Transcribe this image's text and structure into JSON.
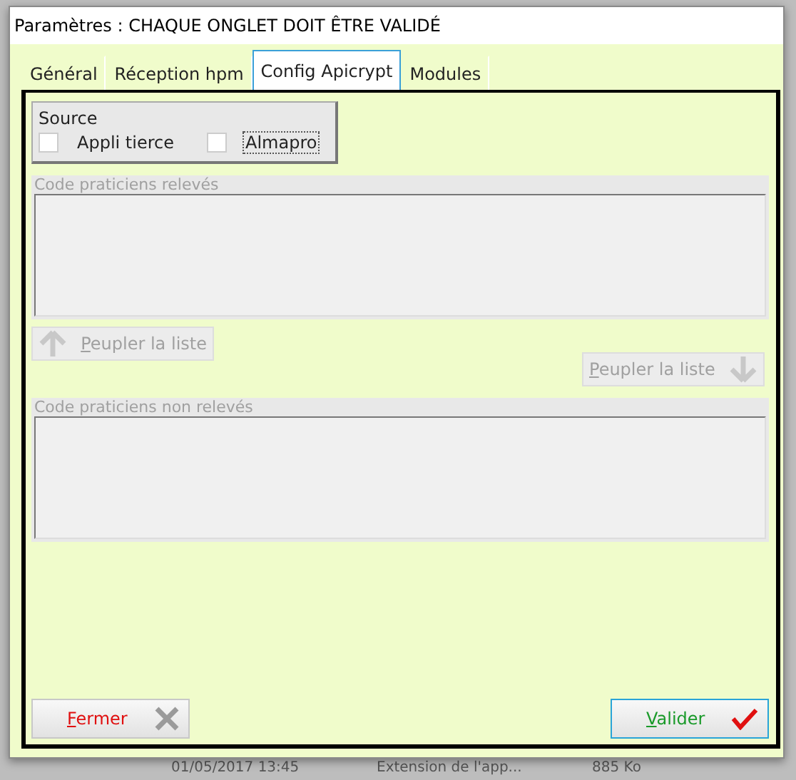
{
  "window": {
    "title": "Paramètres : CHAQUE ONGLET DOIT ÊTRE VALIDÉ"
  },
  "tabs": [
    {
      "label": "Général",
      "selected": false
    },
    {
      "label": "Réception hpm",
      "selected": false
    },
    {
      "label": "Config Apicrypt",
      "selected": true
    },
    {
      "label": "Modules",
      "selected": false
    }
  ],
  "source": {
    "title": "Source",
    "options": [
      {
        "label": "Appli tierce",
        "checked": false,
        "focused": false
      },
      {
        "label": "Almapro",
        "checked": false,
        "focused": true
      }
    ]
  },
  "list_releves": {
    "title": "Code praticiens relevés",
    "disabled": true
  },
  "move_buttons": [
    {
      "label": "Peupler la liste",
      "kind": "up",
      "disabled": true
    },
    {
      "label": "Peupler la liste",
      "kind": "down",
      "disabled": true
    }
  ],
  "list_non_releves": {
    "title": "Code praticiens non relevés",
    "disabled": true
  },
  "buttons": [
    {
      "label": "Fermer",
      "kind": "close"
    },
    {
      "label": "Valider",
      "kind": "validate"
    }
  ],
  "background_row": [
    "01/05/2017 13:45",
    "Extension de l'app...",
    "885 Ko"
  ]
}
